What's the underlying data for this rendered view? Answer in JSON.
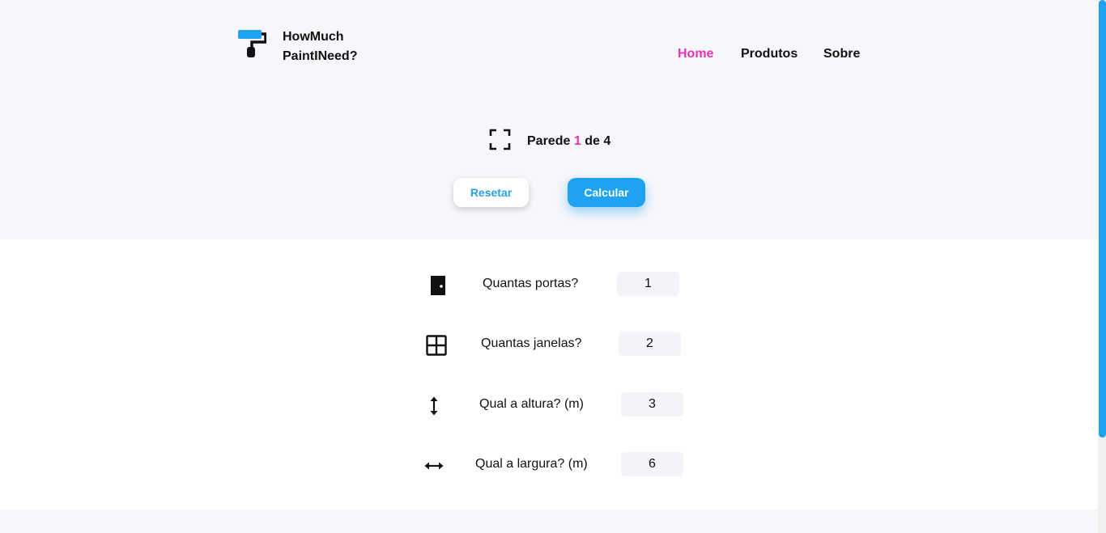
{
  "brand": {
    "line1": "HowMuch",
    "line2": "PaintINeed?",
    "logo_icon": "paint-roller-icon",
    "accent": "#1fa3f0"
  },
  "nav": {
    "home": "Home",
    "products": "Produtos",
    "about": "Sobre",
    "active_color": "#e433b5"
  },
  "wall": {
    "icon": "frame-corners-icon",
    "prefix": "Parede",
    "current": "1",
    "connector": "de",
    "total": "4"
  },
  "actions": {
    "reset": "Resetar",
    "calculate": "Calcular"
  },
  "fields": [
    {
      "icon": "door-icon",
      "label": "Quantas portas?",
      "value": "1"
    },
    {
      "icon": "window-icon",
      "label": "Quantas janelas?",
      "value": "2"
    },
    {
      "icon": "vertical-arrows-icon",
      "label": "Qual a altura? (m)",
      "value": "3"
    },
    {
      "icon": "horizontal-arrows-icon",
      "label": "Qual a largura? (m)",
      "value": "6"
    }
  ]
}
